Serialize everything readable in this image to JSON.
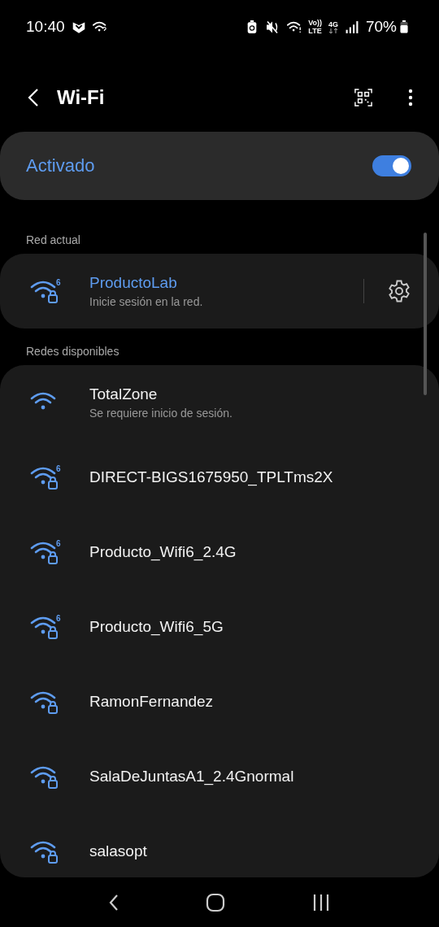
{
  "status_bar": {
    "time": "10:40",
    "volte_top": "Vo))",
    "volte_bottom": "LTE",
    "network_type": "4G",
    "battery": "70%"
  },
  "header": {
    "title": "Wi-Fi"
  },
  "master_switch": {
    "label": "Activado",
    "on": true
  },
  "current_section": {
    "title": "Red actual"
  },
  "current_network": {
    "name": "ProductoLab",
    "status": "Inicie sesión en la red.",
    "badge": "6",
    "locked": true
  },
  "available_section": {
    "title": "Redes disponibles"
  },
  "networks": [
    {
      "name": "TotalZone",
      "status": "Se requiere inicio de sesión.",
      "locked": false
    },
    {
      "name": "DIRECT-BIGS1675950_TPLTms2X",
      "badge": "6",
      "locked": true
    },
    {
      "name": "Producto_Wifi6_2.4G",
      "badge": "6",
      "locked": true
    },
    {
      "name": "Producto_Wifi6_5G",
      "badge": "6",
      "locked": true
    },
    {
      "name": "RamonFernandez",
      "locked": true
    },
    {
      "name": "SalaDeJuntasA1_2.4Gnormal",
      "locked": true
    },
    {
      "name": "salasopt",
      "locked": true
    }
  ]
}
